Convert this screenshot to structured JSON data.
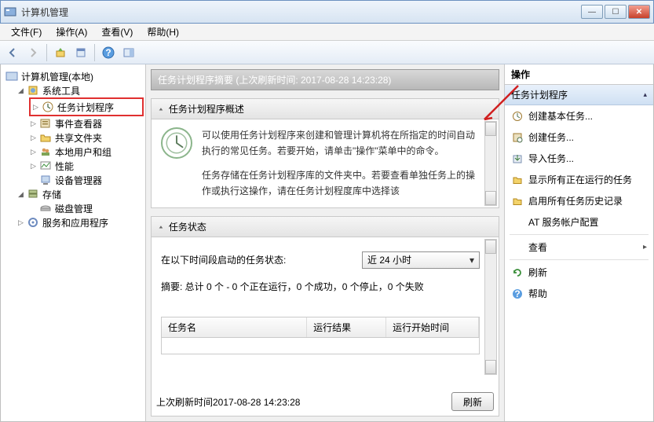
{
  "window": {
    "title": "计算机管理"
  },
  "menu": {
    "file": "文件(F)",
    "action": "操作(A)",
    "view": "查看(V)",
    "help": "帮助(H)"
  },
  "tree": {
    "root": "计算机管理(本地)",
    "system_tools": "系统工具",
    "task_scheduler": "任务计划程序",
    "event_viewer": "事件查看器",
    "shared_folders": "共享文件夹",
    "local_users": "本地用户和组",
    "performance": "性能",
    "device_manager": "设备管理器",
    "storage": "存储",
    "disk_mgmt": "磁盘管理",
    "services_apps": "服务和应用程序"
  },
  "center": {
    "summary_title": "任务计划程序摘要 (上次刷新时间: 2017-08-28 14:23:28)",
    "overview_title": "任务计划程序概述",
    "overview_text1": "可以使用任务计划程序来创建和管理计算机将在所指定的时间自动执行的常见任务。若要开始，请单击\"操作\"菜单中的命令。",
    "overview_text2": "任务存储在任务计划程序库的文件夹中。若要查看单独任务上的操作或执行这操作，请在任务计划程度库中选择该",
    "status_title": "任务状态",
    "status_row_label": "在以下时间段启动的任务状态:",
    "status_dropdown": "近 24 小时",
    "summary_line": "摘要: 总计 0 个 - 0 个正在运行，0 个成功，0 个停止，0 个失败",
    "col_name": "任务名",
    "col_result": "运行结果",
    "col_start": "运行开始时间",
    "last_refresh": "上次刷新时间2017-08-28 14:23:28",
    "refresh_btn": "刷新"
  },
  "actions": {
    "header": "操作",
    "category": "任务计划程序",
    "create_basic": "创建基本任务...",
    "create_task": "创建任务...",
    "import_task": "导入任务...",
    "show_running": "显示所有正在运行的任务",
    "enable_history": "启用所有任务历史记录",
    "at_service": "AT 服务帐户配置",
    "view": "查看",
    "refresh": "刷新",
    "help": "帮助"
  },
  "chart_data": {
    "type": "table",
    "title": "任务状态",
    "columns": [
      "任务名",
      "运行结果",
      "运行开始时间"
    ],
    "rows": [],
    "summary": {
      "total": 0,
      "running": 0,
      "success": 0,
      "stopped": 0,
      "failed": 0
    },
    "period": "近 24 小时",
    "last_refresh": "2017-08-28 14:23:28"
  }
}
